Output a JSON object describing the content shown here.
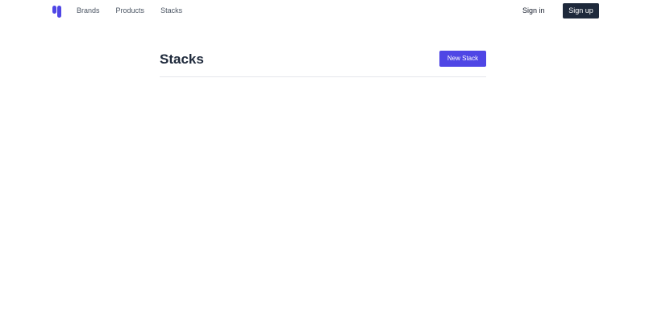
{
  "nav": {
    "logo_icon": "brand-logo-icon",
    "links": [
      "Brands",
      "Products",
      "Stacks"
    ],
    "signin_label": "Sign in",
    "signup_label": "Sign up"
  },
  "main": {
    "title": "Stacks",
    "new_stack_label": "New Stack"
  },
  "colors": {
    "accent": "#4f46e5",
    "dark": "#1e293b",
    "logo": "#4f46e5"
  }
}
